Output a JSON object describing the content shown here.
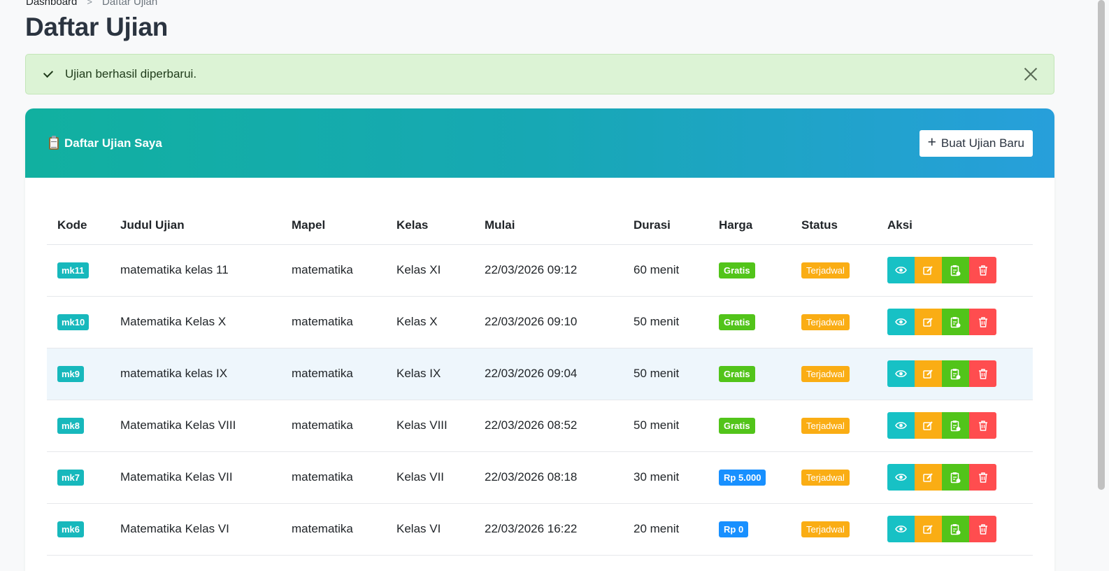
{
  "breadcrumb": {
    "home": "Dashboard",
    "separator": ">",
    "current": "Daftar Ujian"
  },
  "page_title": "Daftar Ujian",
  "alert": {
    "message": "Ujian berhasil diperbarui.",
    "icon": "check-icon",
    "close_icon": "close-icon"
  },
  "card": {
    "title": "Daftar Ujian Saya",
    "title_icon": "clipboard-icon",
    "create_button": {
      "icon": "plus-icon",
      "label": "Buat Ujian Baru"
    },
    "colors": {
      "gradient_start": "#11b0a0",
      "gradient_end": "#279fdb"
    }
  },
  "table": {
    "columns": [
      "Kode",
      "Judul Ujian",
      "Mapel",
      "Kelas",
      "Mulai",
      "Durasi",
      "Harga",
      "Status",
      "Aksi"
    ],
    "rows": [
      {
        "code": "mk11",
        "title": "matematika kelas 11",
        "subject": "matematika",
        "class": "Kelas XI",
        "start": "22/03/2026 09:12",
        "duration": "60 menit",
        "price": "Gratis",
        "price_type": "free",
        "status": "Terjadwal"
      },
      {
        "code": "mk10",
        "title": "Matematika Kelas X",
        "subject": "matematika",
        "class": "Kelas X",
        "start": "22/03/2026 09:10",
        "duration": "50 menit",
        "price": "Gratis",
        "price_type": "free",
        "status": "Terjadwal"
      },
      {
        "code": "mk9",
        "title": "matematika kelas IX",
        "subject": "matematika",
        "class": "Kelas IX",
        "start": "22/03/2026 09:04",
        "duration": "50 menit",
        "price": "Gratis",
        "price_type": "free",
        "status": "Terjadwal"
      },
      {
        "code": "mk8",
        "title": "Matematika Kelas VIII",
        "subject": "matematika",
        "class": "Kelas VIII",
        "start": "22/03/2026 08:52",
        "duration": "50 menit",
        "price": "Gratis",
        "price_type": "free",
        "status": "Terjadwal"
      },
      {
        "code": "mk7",
        "title": "Matematika Kelas VII",
        "subject": "matematika",
        "class": "Kelas VII",
        "start": "22/03/2026 08:18",
        "duration": "30 menit",
        "price": "Rp 5.000",
        "price_type": "paid",
        "status": "Terjadwal"
      },
      {
        "code": "mk6",
        "title": "Matematika Kelas VI",
        "subject": "matematika",
        "class": "Kelas VI",
        "start": "22/03/2026 16:22",
        "duration": "20 menit",
        "price": "Rp 0",
        "price_type": "paid",
        "status": "Terjadwal"
      }
    ],
    "action_icons": [
      "eye-icon",
      "edit-icon",
      "clipboard-check-icon",
      "trash-icon"
    ]
  },
  "colors": {
    "code_badge": "#17b8bc",
    "price_free": "#52c41a",
    "price_paid": "#1890ff",
    "status_scheduled": "#faad14",
    "action_view": "#17c1c5",
    "action_edit": "#faad14",
    "action_results": "#52c41a",
    "action_delete": "#ff4d4f"
  }
}
